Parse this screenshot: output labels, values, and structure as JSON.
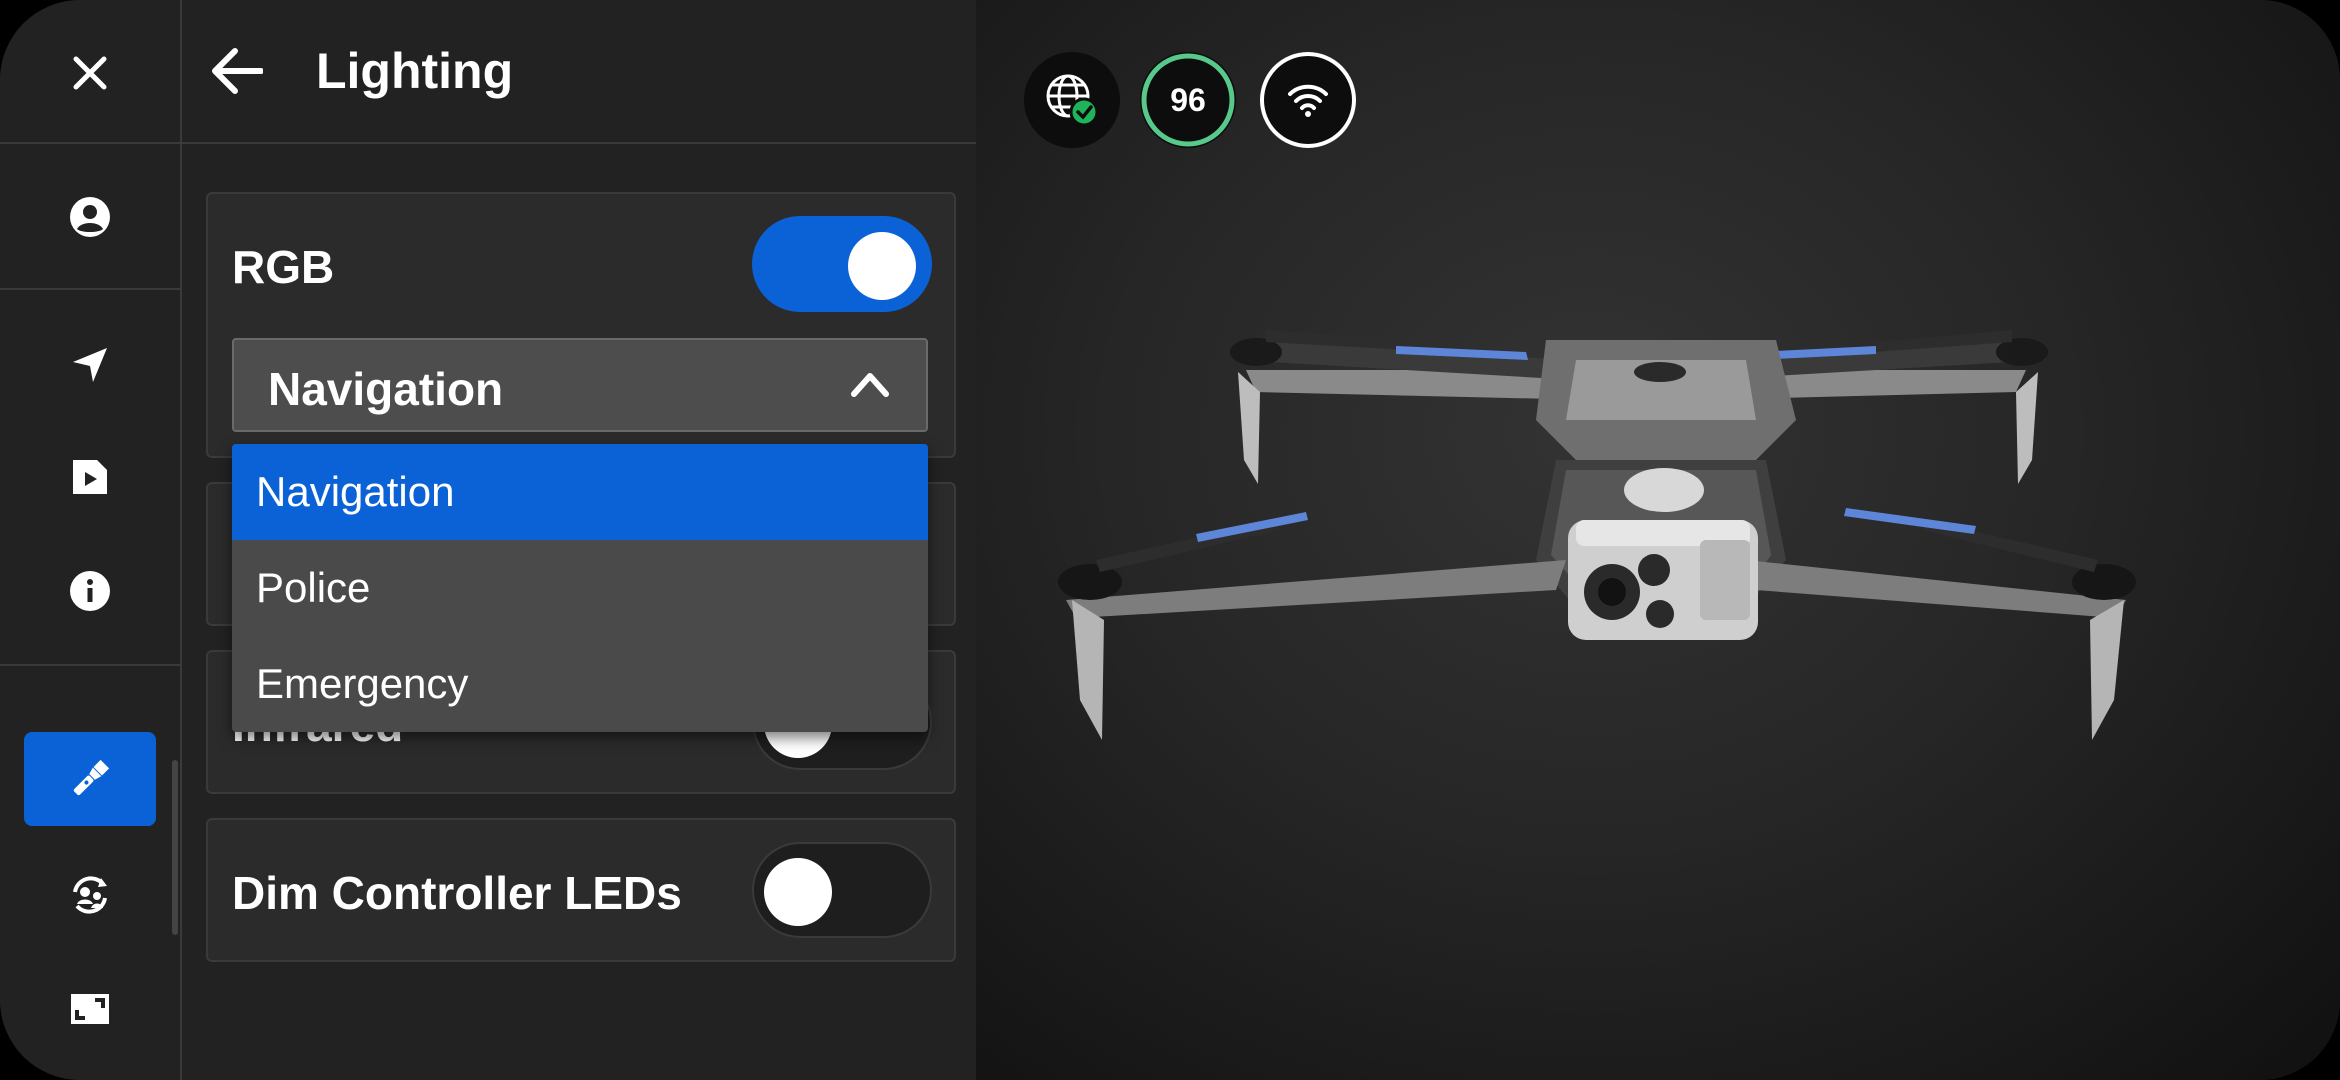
{
  "header": {
    "title": "Lighting"
  },
  "rail": {
    "items": [
      {
        "name": "close-icon"
      },
      {
        "name": "account-icon"
      },
      {
        "name": "navigate-icon"
      },
      {
        "name": "media-icon"
      },
      {
        "name": "info-icon"
      },
      {
        "name": "flashlight-icon",
        "active": true
      },
      {
        "name": "user-sync-icon"
      },
      {
        "name": "fullscreen-icon"
      }
    ]
  },
  "settings": {
    "rgb": {
      "label": "RGB",
      "enabled": true,
      "selected": "Navigation"
    },
    "infrared": {
      "label": "Infrared",
      "enabled": false
    },
    "dim_leds": {
      "label": "Dim Controller LEDs",
      "enabled": false
    }
  },
  "dropdown": {
    "options": [
      "Navigation",
      "Police",
      "Emergency"
    ],
    "selected_index": 0
  },
  "status": {
    "battery": "96",
    "battery_level_percent": 96,
    "gps_icon": "globe-check-icon",
    "wifi_icon": "wifi-icon",
    "accent": "#0a62d6",
    "ok_color": "#1fb35a"
  }
}
